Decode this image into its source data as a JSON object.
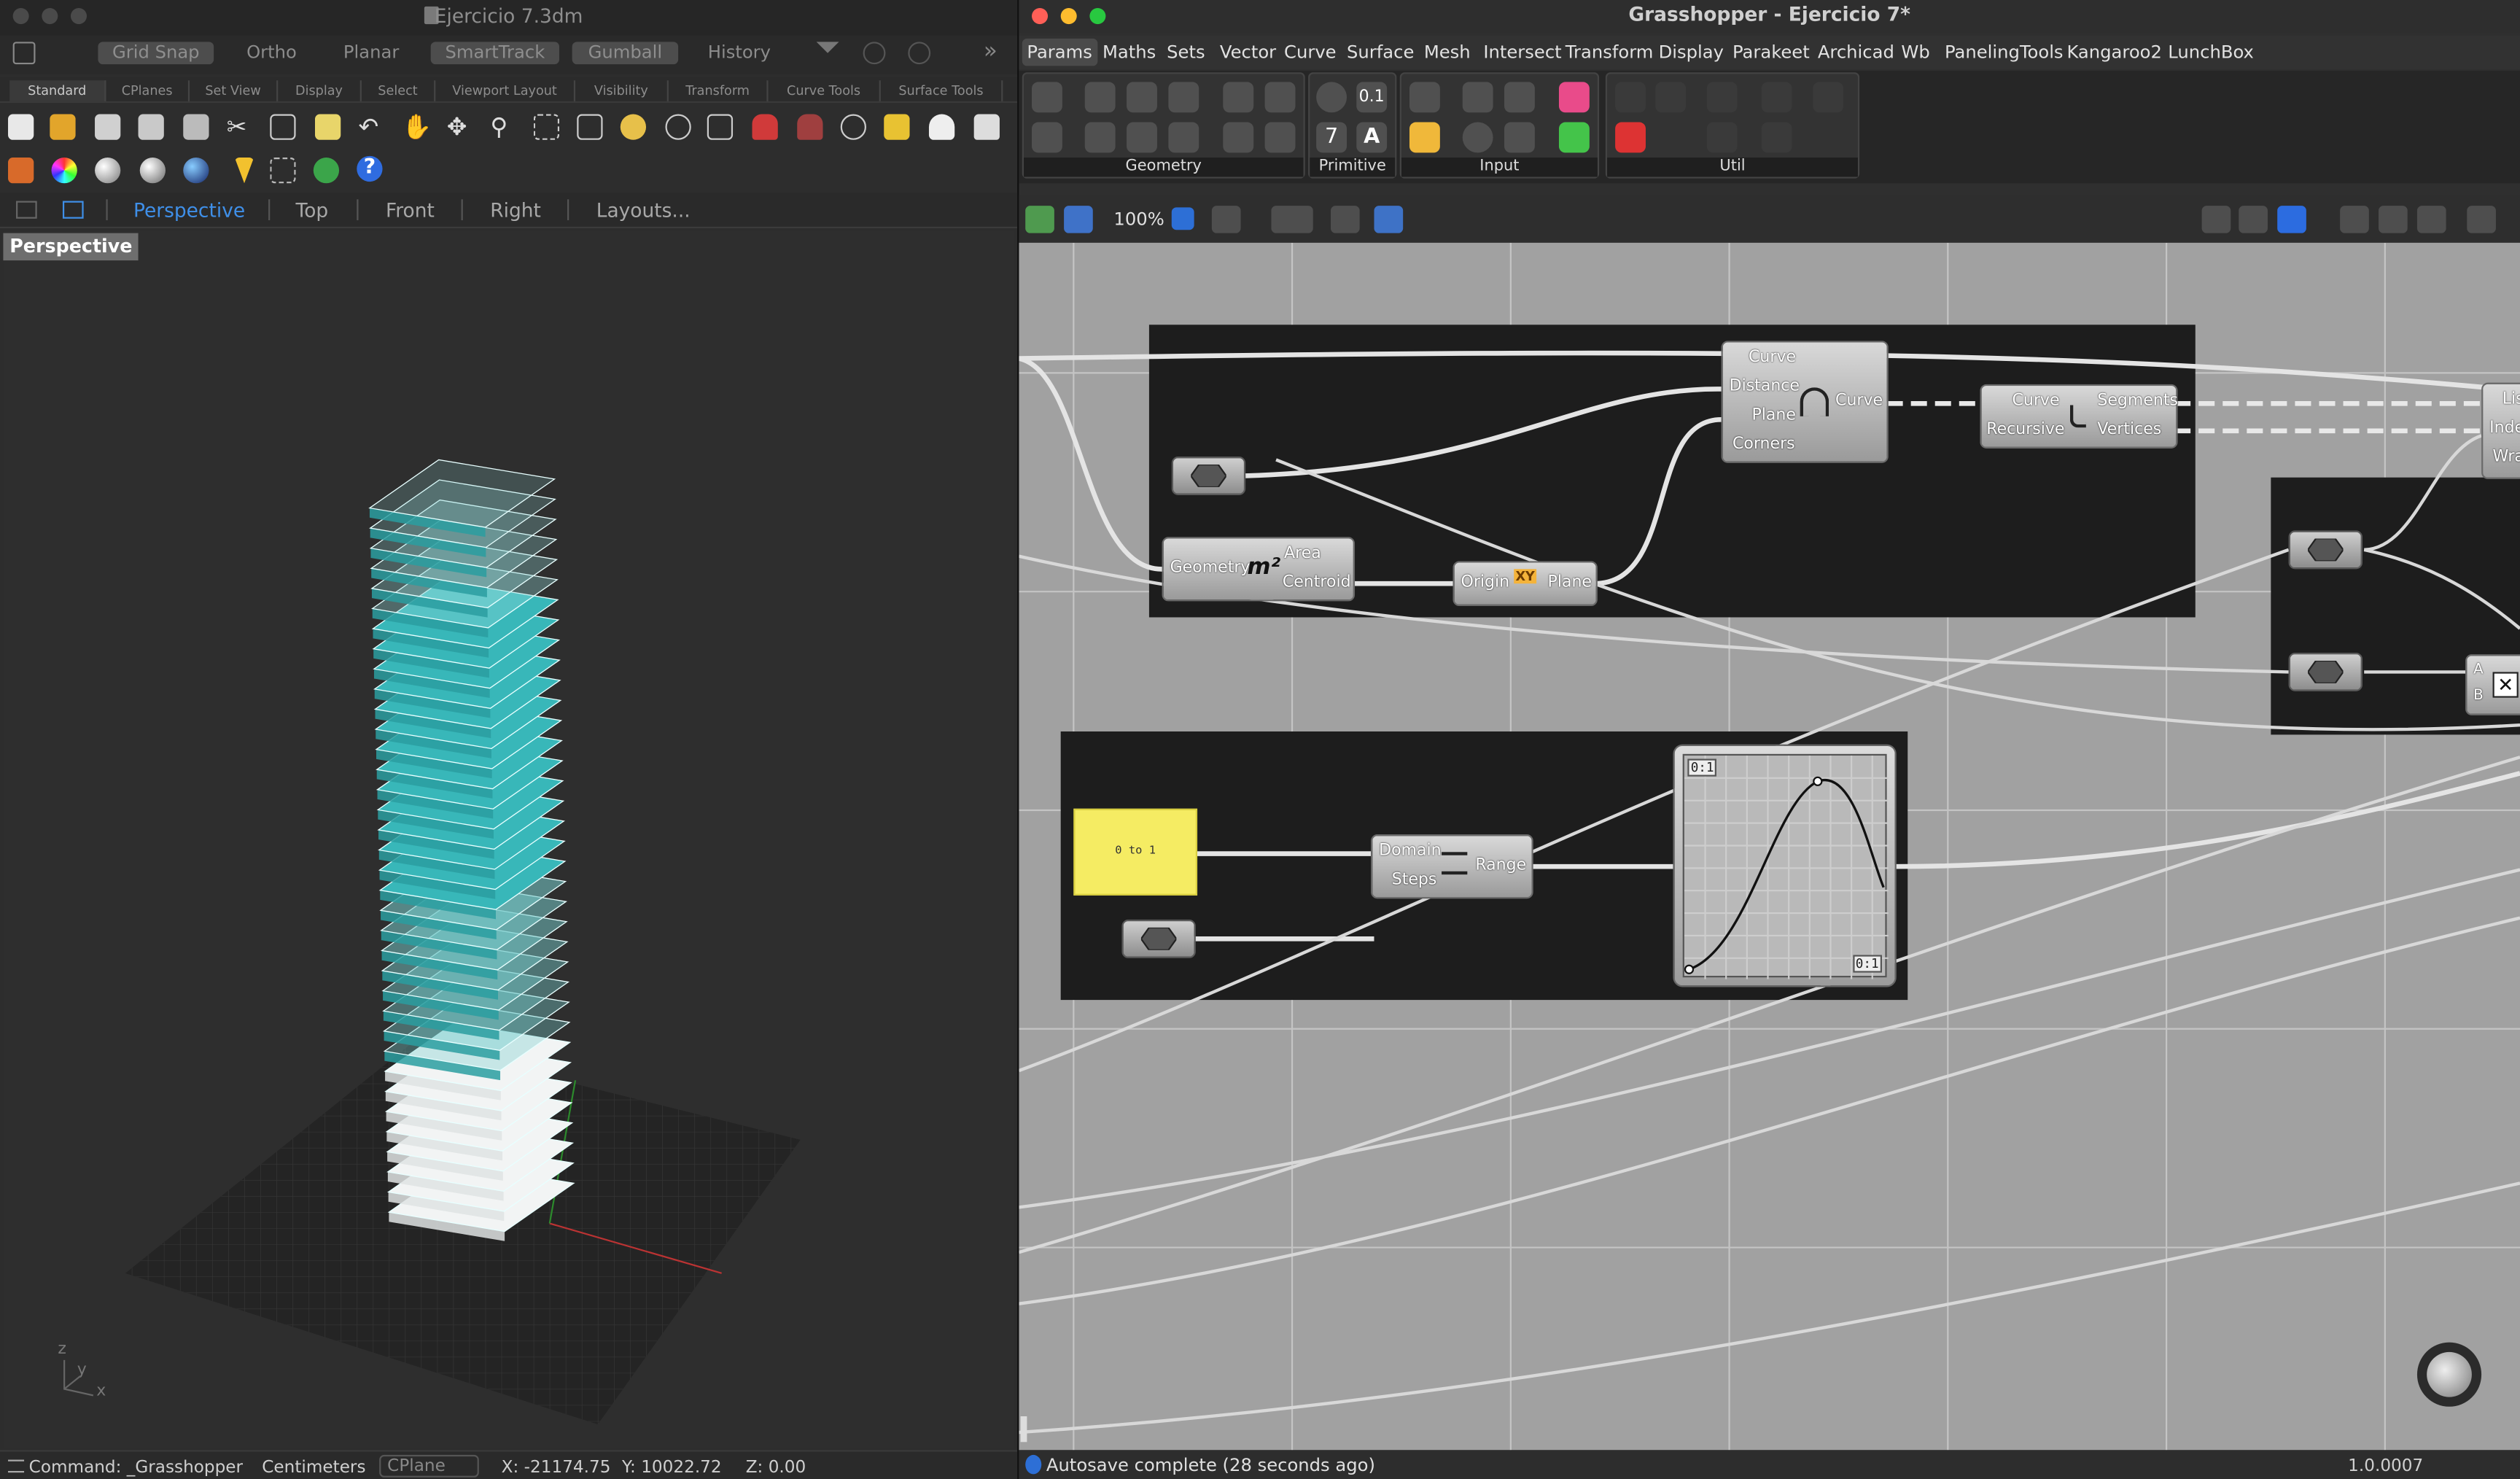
{
  "rhino": {
    "title": "Ejercicio 7.3dm",
    "toggles": [
      "Grid Snap",
      "Ortho",
      "Planar",
      "SmartTrack",
      "Gumball",
      "History"
    ],
    "tabs": [
      "Standard",
      "CPlanes",
      "Set View",
      "Display",
      "Select",
      "Viewport Layout",
      "Visibility",
      "Transform",
      "Curve Tools",
      "Surface Tools"
    ],
    "viewport_tabs": [
      "Perspective",
      "Top",
      "Front",
      "Right",
      "Layouts..."
    ],
    "viewport_label": "Perspective",
    "axis": {
      "z": "z",
      "y": "y",
      "x": "x"
    },
    "status": {
      "command": "Command: _Grasshopper",
      "units": "Centimeters",
      "cplane": "CPlane",
      "x": "X: -21174.75",
      "y": "Y: 10022.72",
      "z": "Z: 0.00"
    }
  },
  "gh": {
    "title": "Grasshopper - Ejercicio 7*",
    "tabs": [
      "Params",
      "Maths",
      "Sets",
      "Vector",
      "Curve",
      "Surface",
      "Mesh",
      "Intersect",
      "Transform",
      "Display",
      "Parakeet",
      "Archicad",
      "Wb",
      "PanelingTools",
      "Kangaroo2",
      "LunchBox"
    ],
    "ribbon_groups": [
      "Geometry",
      "Primitive",
      "Input",
      "Util"
    ],
    "zoom": "100%",
    "status": "Autosave complete (28 seconds ago)",
    "version": "1.0.0007",
    "components": {
      "offset": {
        "inputs": [
          "Curve",
          "Distance",
          "Plane",
          "Corners"
        ],
        "output": "Curve"
      },
      "explode": {
        "inputs": [
          "Curve",
          "Recursive"
        ],
        "outputs": [
          "Segments",
          "Vertices"
        ]
      },
      "area": {
        "input": "Geometry",
        "outputs": [
          "Area",
          "Centroid"
        ],
        "icon": "m²"
      },
      "plane": {
        "input": "Origin",
        "output": "Plane",
        "icon": "XY"
      },
      "range": {
        "inputs": [
          "Domain",
          "Steps"
        ],
        "output": "Range"
      },
      "panel_text": "0 to 1",
      "graph": {
        "top_left": "0:1",
        "bottom_right": "0:1"
      },
      "list_partial": [
        "Lis",
        "Inde",
        "Wra"
      ],
      "cross_inputs": [
        "A",
        "B"
      ]
    }
  },
  "colors": {
    "rhino_accent": "#3f8fe8",
    "gh_canvas": "#a1a1a1",
    "gh_group": "#1d1d1d",
    "panel_yellow": "#f5ec63",
    "floor_cyan": "#38b7b9"
  }
}
